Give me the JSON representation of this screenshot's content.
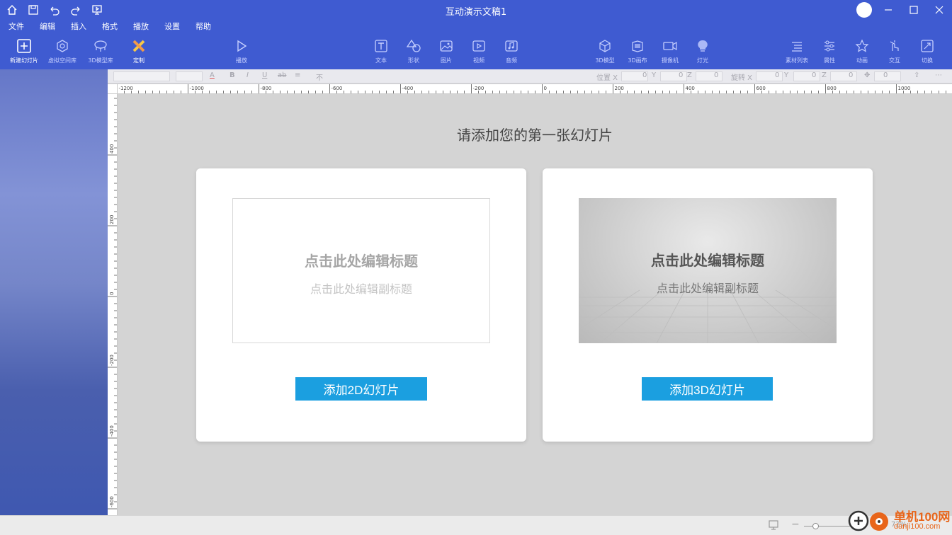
{
  "window": {
    "title": "互动演示文稿1"
  },
  "quick_access": [
    {
      "icon": "home-icon"
    },
    {
      "icon": "save-icon"
    },
    {
      "icon": "undo-icon"
    },
    {
      "icon": "redo-icon"
    },
    {
      "icon": "present-icon"
    }
  ],
  "menu": [
    "文件",
    "编辑",
    "插入",
    "格式",
    "播放",
    "设置",
    "帮助"
  ],
  "ribbon": [
    {
      "label": "新建幻灯片",
      "icon": "new-slide-icon"
    },
    {
      "label": "虚拟空间库",
      "icon": "virtual-space-icon"
    },
    {
      "label": "3D模型库",
      "icon": "model-library-icon"
    },
    {
      "label": "定制",
      "icon": "customize-icon"
    },
    {
      "label": "播放",
      "icon": "play-icon"
    },
    {
      "label": "文本",
      "icon": "text-icon"
    },
    {
      "label": "形状",
      "icon": "shape-icon"
    },
    {
      "label": "图片",
      "icon": "image-icon"
    },
    {
      "label": "视频",
      "icon": "video-icon"
    },
    {
      "label": "音频",
      "icon": "audio-icon"
    },
    {
      "label": "3D模型",
      "icon": "cube-icon"
    },
    {
      "label": "3D画布",
      "icon": "canvas3d-icon"
    },
    {
      "label": "摄像机",
      "icon": "camera-icon"
    },
    {
      "label": "灯光",
      "icon": "light-icon"
    },
    {
      "label": "素材列表",
      "icon": "list-icon"
    },
    {
      "label": "属性",
      "icon": "sliders-icon"
    },
    {
      "label": "动画",
      "icon": "star-icon"
    },
    {
      "label": "交互",
      "icon": "interact-icon"
    },
    {
      "label": "切换",
      "icon": "transition-icon"
    }
  ],
  "format_bar": {
    "pos_x_label": "位置 X",
    "pos_x_value": "0",
    "y_label": "Y",
    "y_value": "0",
    "z_label": "Z",
    "z_value": "0",
    "rot_label": "旋转 X",
    "rot_x_value": "0",
    "rot_y_label": "Y",
    "rot_y_value": "0",
    "rot_z_label": "Z",
    "rot_z_value": "0",
    "scale_value": "0"
  },
  "ruler": {
    "h_labels": [
      "-1200",
      "-1000",
      "-800",
      "-600",
      "-400",
      "-200",
      "0",
      "200",
      "400",
      "600",
      "800",
      "1000"
    ],
    "v_labels": [
      "400",
      "200",
      "0",
      "-200",
      "-400",
      "-600"
    ]
  },
  "canvas": {
    "headline": "请添加您的第一张幻灯片",
    "cards": [
      {
        "type": "2d",
        "thumb_title": "点击此处编辑标题",
        "thumb_subtitle": "点击此处编辑副标题",
        "button": "添加2D幻灯片"
      },
      {
        "type": "3d",
        "thumb_title": "点击此处编辑标题",
        "thumb_subtitle": "点击此处编辑副标题",
        "button": "添加3D幻灯片"
      }
    ]
  },
  "status": {
    "zoom": "72%"
  },
  "watermark": {
    "brand": "单机100网",
    "url": "danji100.com"
  },
  "colors": {
    "titlebar": "#3f5bd1",
    "button": "#1b9fe0",
    "watermark": "#e8651a"
  }
}
